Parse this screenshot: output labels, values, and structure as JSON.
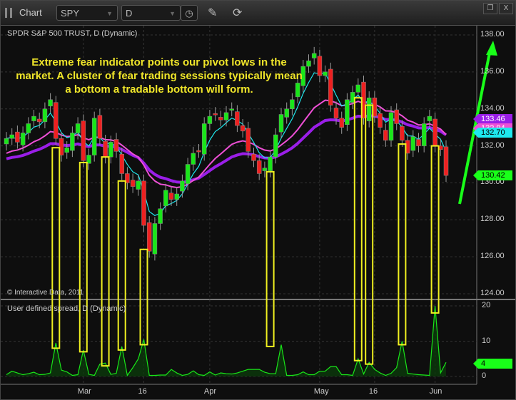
{
  "window": {
    "title": "Chart",
    "symbol": "SPY",
    "interval": "D",
    "icons": [
      "grip-icon",
      "clock-icon",
      "pencil-icon",
      "refresh-icon",
      "restore-icon",
      "close-icon"
    ],
    "close_label": "X"
  },
  "main_panel": {
    "title": "SPDR S&P 500 TRUST, D (Dynamic)",
    "copyright": "© Interactive Data, 2011",
    "annotation": "Extreme fear indicator points our pivot lows in the market. A cluster of fear trading sessions typically mean a bottom a tradable bottom will form.",
    "price_ticks": [
      "138.00",
      "136.00",
      "134.00",
      "132.00",
      "130.00",
      "128.00",
      "126.00",
      "124.00"
    ],
    "price_tags": [
      {
        "label": "133.46",
        "color": "#9a1ee8"
      },
      {
        "label": "132.94",
        "color": "#ee4fd6"
      },
      {
        "label": "132.70",
        "color": "#1ee8ee"
      },
      {
        "label": "130.42",
        "color": "#19ff19"
      }
    ]
  },
  "lower_panel": {
    "title": "User defined spread, D (Dynamic)",
    "ticks": [
      "20",
      "10",
      "0"
    ],
    "last_tag": "4"
  },
  "date_ticks": [
    {
      "label": "Mar",
      "idx": 14
    },
    {
      "label": "16",
      "idx": 25
    },
    {
      "label": "Apr",
      "idx": 37
    },
    {
      "label": "May",
      "idx": 57
    },
    {
      "label": "16",
      "idx": 67
    },
    {
      "label": "Jun",
      "idx": 78
    }
  ],
  "chart_data": {
    "type": "candlestick",
    "title": "SPDR S&P 500 TRUST, D (Dynamic)",
    "ylim": [
      124,
      138
    ],
    "closes": [
      132.4,
      132.6,
      132.2,
      132.7,
      133.2,
      133.6,
      133.3,
      134.0,
      134.5,
      132.4,
      131.5,
      131.9,
      132.7,
      133.2,
      131.2,
      131.5,
      133.5,
      132.4,
      131.4,
      132.2,
      131.7,
      130.5,
      130.0,
      129.8,
      130.1,
      127.7,
      126.3,
      127.8,
      128.6,
      129.6,
      129.1,
      129.4,
      130.1,
      131.0,
      131.6,
      131.7,
      133.2,
      133.6,
      133.7,
      133.4,
      133.8,
      134.0,
      133.1,
      132.8,
      131.7,
      131.2,
      130.5,
      130.8,
      131.4,
      132.6,
      133.7,
      134.0,
      134.5,
      135.4,
      136.3,
      136.6,
      137.0,
      135.8,
      136.0,
      134.2,
      133.5,
      133.0,
      134.5,
      134.9,
      135.3,
      133.5,
      134.6,
      133.6,
      133.0,
      132.3,
      133.8,
      133.2,
      132.3,
      131.6,
      132.5,
      132.0,
      133.2,
      133.6,
      132.0,
      131.8,
      130.4
    ],
    "spread": {
      "name": "User defined spread",
      "ylim": [
        0,
        22
      ],
      "values": [
        0.5,
        1.5,
        1,
        0.5,
        0.8,
        1.2,
        0.5,
        0.6,
        1,
        9.5,
        1.8,
        1.3,
        0.3,
        0.5,
        7.5,
        0.6,
        0.3,
        3.5,
        3.8,
        0.6,
        0.9,
        8.5,
        0.3,
        2.5,
        5,
        10.5,
        0.3,
        0.3,
        0.4,
        0.4,
        2,
        1,
        0.3,
        0.6,
        1.6,
        0.5,
        0.3,
        1.3,
        0.4,
        1,
        0.8,
        0.7,
        1,
        1.5,
        2,
        2,
        2,
        1.2,
        0.8,
        0.8,
        9,
        0.3,
        0.3,
        0.5,
        1.3,
        0.5,
        0.5,
        1.5,
        1.5,
        2.8,
        2.8,
        0.5,
        0.5,
        0.3,
        5,
        0.7,
        4,
        2,
        1,
        0.3,
        0.9,
        2.5,
        10,
        0.9,
        0.7,
        0.5,
        0.4,
        0.3,
        20,
        1,
        4
      ]
    },
    "fear_boxes": [
      {
        "idx": 9,
        "price": 131.9,
        "spread": 8
      },
      {
        "idx": 14,
        "price": 131.1,
        "spread": 7
      },
      {
        "idx": 18,
        "price": 131.4,
        "spread": 3
      },
      {
        "idx": 21,
        "price": 130.1,
        "spread": 7.5
      },
      {
        "idx": 25,
        "price": 126.4,
        "spread": 9
      },
      {
        "idx": 48,
        "price": 130.6,
        "spread": 8.5
      },
      {
        "idx": 64,
        "price": 134.6,
        "spread": 4.5
      },
      {
        "idx": 66,
        "price": 134.2,
        "spread": 3.5
      },
      {
        "idx": 72,
        "price": 132.1,
        "spread": 9
      },
      {
        "idx": 78,
        "price": 132.0,
        "spread": 18
      }
    ],
    "series": [
      {
        "name": "fast MA",
        "color": "#1ee8ee",
        "last": 132.7
      },
      {
        "name": "mid MA",
        "color": "#ee4fd6",
        "last": 132.94
      },
      {
        "name": "slow MA",
        "color": "#9a1ee8",
        "last": 133.46
      }
    ]
  }
}
